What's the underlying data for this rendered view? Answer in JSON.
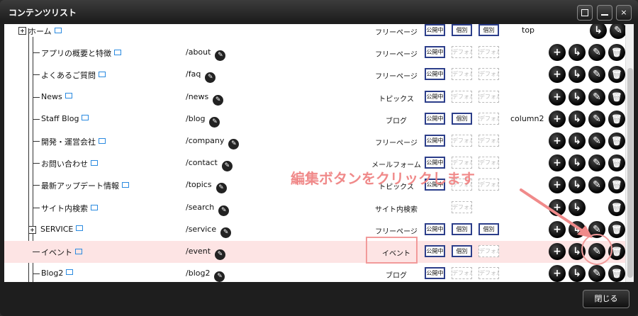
{
  "window": {
    "title": "コンテンツリスト",
    "controls": {
      "maximize": "□",
      "minimize": "—",
      "close": "×"
    }
  },
  "header_row": {
    "name": "ホーム",
    "type": "フリーページ",
    "badges": [
      "公開中",
      "個別",
      "個別"
    ],
    "layout": "top"
  },
  "rows": [
    {
      "name": "アプリの概要と特徴",
      "url": "/about",
      "type": "フリーページ",
      "badges": [
        "公開中",
        "デフォルト",
        "デフォルト"
      ],
      "layout": ""
    },
    {
      "name": "よくあるご質問",
      "url": "/faq",
      "type": "フリーページ",
      "badges": [
        "公開中",
        "デフォルト",
        "デフォルト"
      ],
      "layout": ""
    },
    {
      "name": "News",
      "url": "/news",
      "type": "トピックス",
      "badges": [
        "公開中",
        "デフォルト",
        "デフォルト"
      ],
      "layout": ""
    },
    {
      "name": "Staff Blog",
      "url": "/blog",
      "type": "ブログ",
      "badges": [
        "公開中",
        "個別",
        "デフォルト"
      ],
      "layout": "column2"
    },
    {
      "name": "開発・運営会社",
      "url": "/company",
      "type": "フリーページ",
      "badges": [
        "公開中",
        "デフォルト",
        "デフォルト"
      ],
      "layout": ""
    },
    {
      "name": "お問い合わせ",
      "url": "/contact",
      "type": "メールフォーム",
      "badges": [
        "公開中",
        "デフォルト",
        "デフォルト"
      ],
      "layout": ""
    },
    {
      "name": "最新アップデート情報",
      "url": "/topics",
      "type": "トピックス",
      "badges": [
        "公開中",
        "デフォルト",
        "デフォルト"
      ],
      "layout": ""
    },
    {
      "name": "サイト内検索",
      "url": "/search",
      "type": "サイト内検索",
      "badges": [
        "",
        "デフォルト",
        ""
      ],
      "layout": ""
    },
    {
      "name": "SERVICE",
      "url": "/service",
      "type": "フリーページ",
      "badges": [
        "公開中",
        "個別",
        "個別"
      ],
      "layout": ""
    },
    {
      "name": "イベント",
      "url": "/event",
      "type": "イベント",
      "badges": [
        "公開中",
        "個別",
        "デフォルト"
      ],
      "layout": ""
    },
    {
      "name": "Blog2",
      "url": "/blog2",
      "type": "ブログ",
      "badges": [
        "公開中",
        "デフォルト",
        "デフォルト"
      ],
      "layout": ""
    }
  ],
  "icons": {
    "add": "+",
    "move": "↳",
    "edit": "✎",
    "delete": "🗑"
  },
  "annotation": {
    "text": "編集ボタンをクリックします",
    "color": "#f08a8a"
  },
  "footer": {
    "close_label": "閉じる"
  }
}
